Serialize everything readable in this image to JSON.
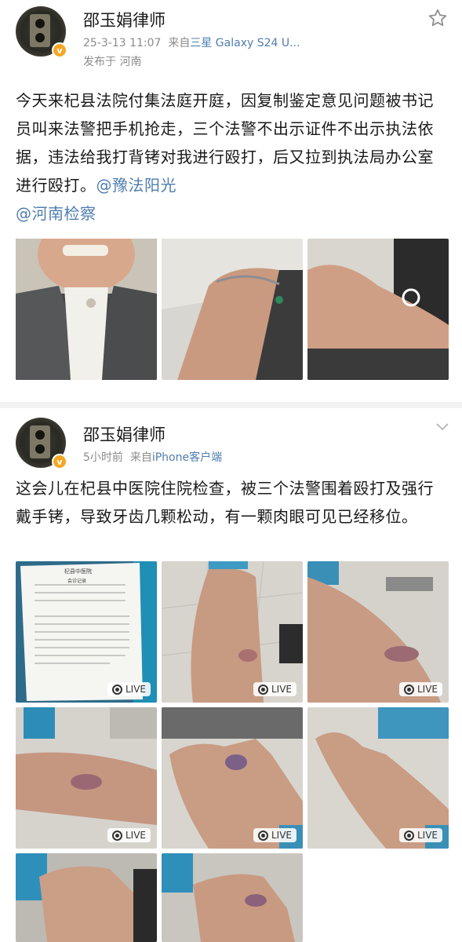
{
  "post1": {
    "author": "邵玉娟律师",
    "time": "25-3-13 11:07",
    "source_prefix": "来自",
    "source": "三星 Galaxy S24 U...",
    "location": "发布于 河南",
    "text": "今天来杞县法院付集法庭开庭，因复制鉴定意见问题被书记员叫来法警把手机抢走，三个法警不出示证件不出示执法依据，违法给我打背铐对我进行殴打，后又拉到执法局办公室进行殴打。",
    "mentions": [
      "@豫法阳光",
      "@河南检察"
    ],
    "images": [
      {
        "alt": "woman face photo"
      },
      {
        "alt": "arm with bracelet"
      },
      {
        "alt": "arm close-up"
      }
    ]
  },
  "post2": {
    "author": "邵玉娟律师",
    "time": "5小时前",
    "source_prefix": "来自",
    "source": "iPhone客户端",
    "text": "这会儿在杞县中医院住院检查，被三个法警围着殴打及强行戴手铐，导致牙齿几颗松动，有一颗肉眼可见已经移位。",
    "live_label": "LIVE",
    "images": [
      {
        "alt": "medical record",
        "live": true
      },
      {
        "alt": "bruised forearm",
        "live": true
      },
      {
        "alt": "bruised elbow",
        "live": true
      },
      {
        "alt": "bruised arm",
        "live": true
      },
      {
        "alt": "bruised hand",
        "live": true
      },
      {
        "alt": "hand wrist",
        "live": true
      },
      {
        "alt": "hand close-up",
        "live": false
      },
      {
        "alt": "hand bruise",
        "live": false
      }
    ],
    "doc": {
      "hospital": "杞县中医院",
      "title": "会诊记录"
    }
  },
  "colors": {
    "link": "#507daf",
    "meta": "#8c8c8c",
    "badge": "#f5a623"
  }
}
